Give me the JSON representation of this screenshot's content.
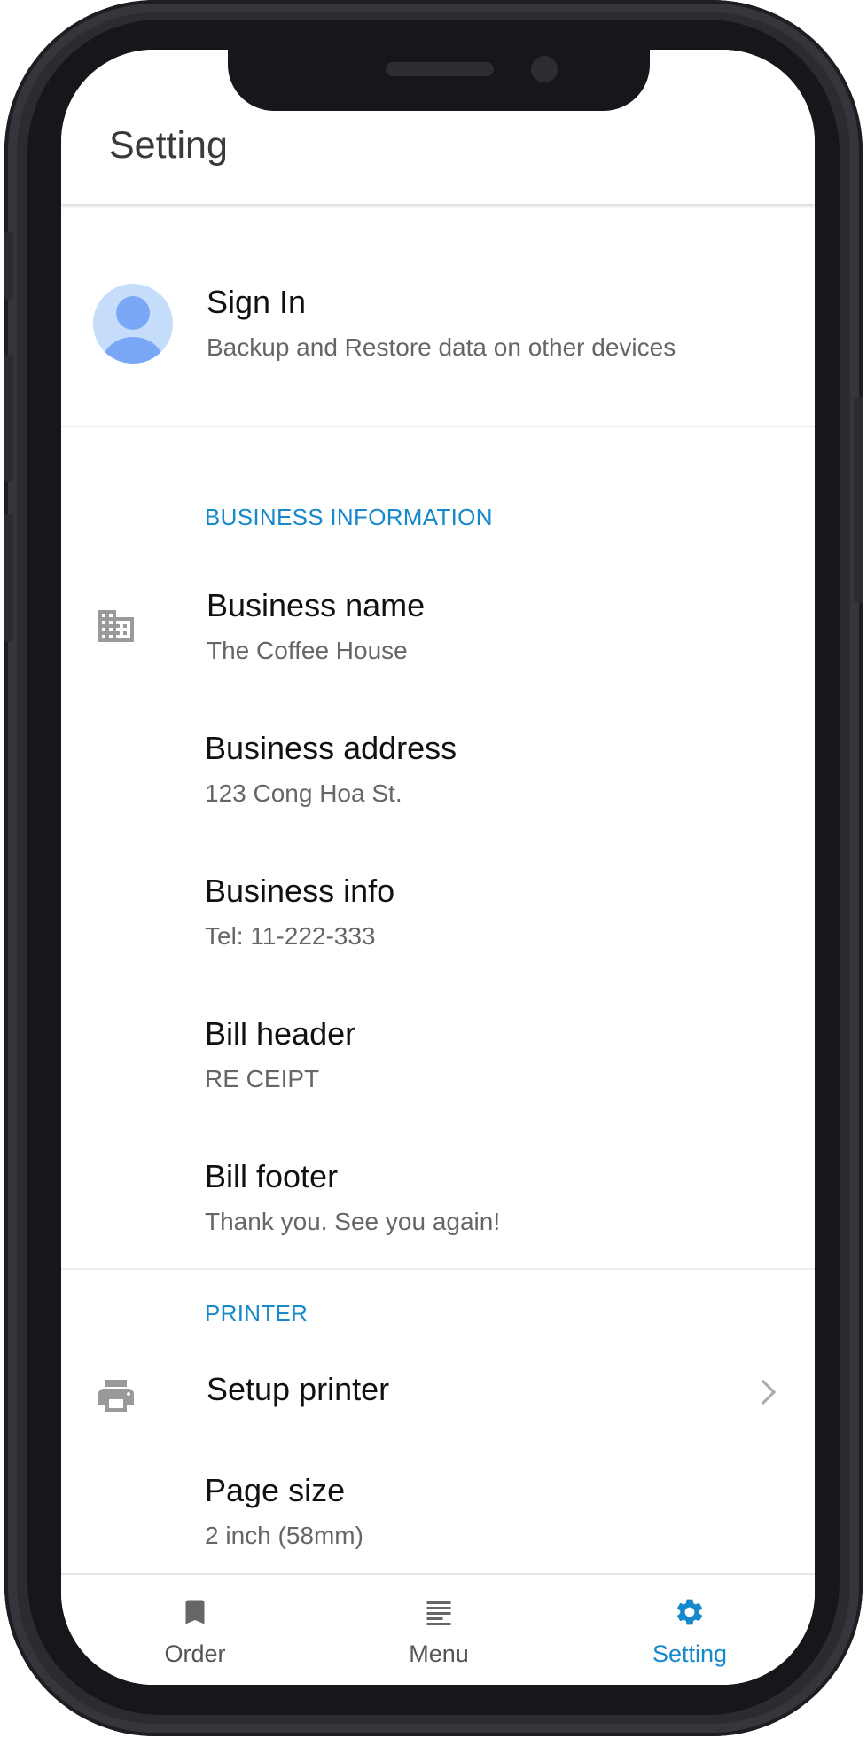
{
  "appbar": {
    "title": "Setting"
  },
  "account": {
    "title": "Sign In",
    "subtitle": "Backup and Restore data on other devices",
    "avatar_icon": "person-avatar-icon"
  },
  "business": {
    "header": "BUSINESS INFORMATION",
    "icon": "business-building-icon",
    "items": [
      {
        "label": "Business name",
        "value": "The  Coffee House"
      },
      {
        "label": "Business address",
        "value": "123 Cong Hoa St."
      },
      {
        "label": "Business info",
        "value": "Tel: 11-222-333"
      },
      {
        "label": "Bill header",
        "value": "RE CEIPT"
      },
      {
        "label": "Bill footer",
        "value": "Thank you. See you again!"
      }
    ]
  },
  "printer": {
    "header": "PRINTER",
    "icon": "printer-icon",
    "setup_label": "Setup printer",
    "page_size_label": "Page size",
    "page_size_value": "2 inch (58mm)"
  },
  "bottom_nav": {
    "items": [
      {
        "label": "Order",
        "icon": "bookmark-icon"
      },
      {
        "label": "Menu",
        "icon": "menu-lines-icon"
      },
      {
        "label": "Setting",
        "icon": "gear-icon",
        "active": true
      }
    ]
  },
  "colors": {
    "accent": "#1689cc",
    "icon_gray": "#9a9a9a",
    "avatar_bg": "#c6dcfb",
    "avatar_fg": "#7aa8f6",
    "frame": "#2b2c31"
  }
}
